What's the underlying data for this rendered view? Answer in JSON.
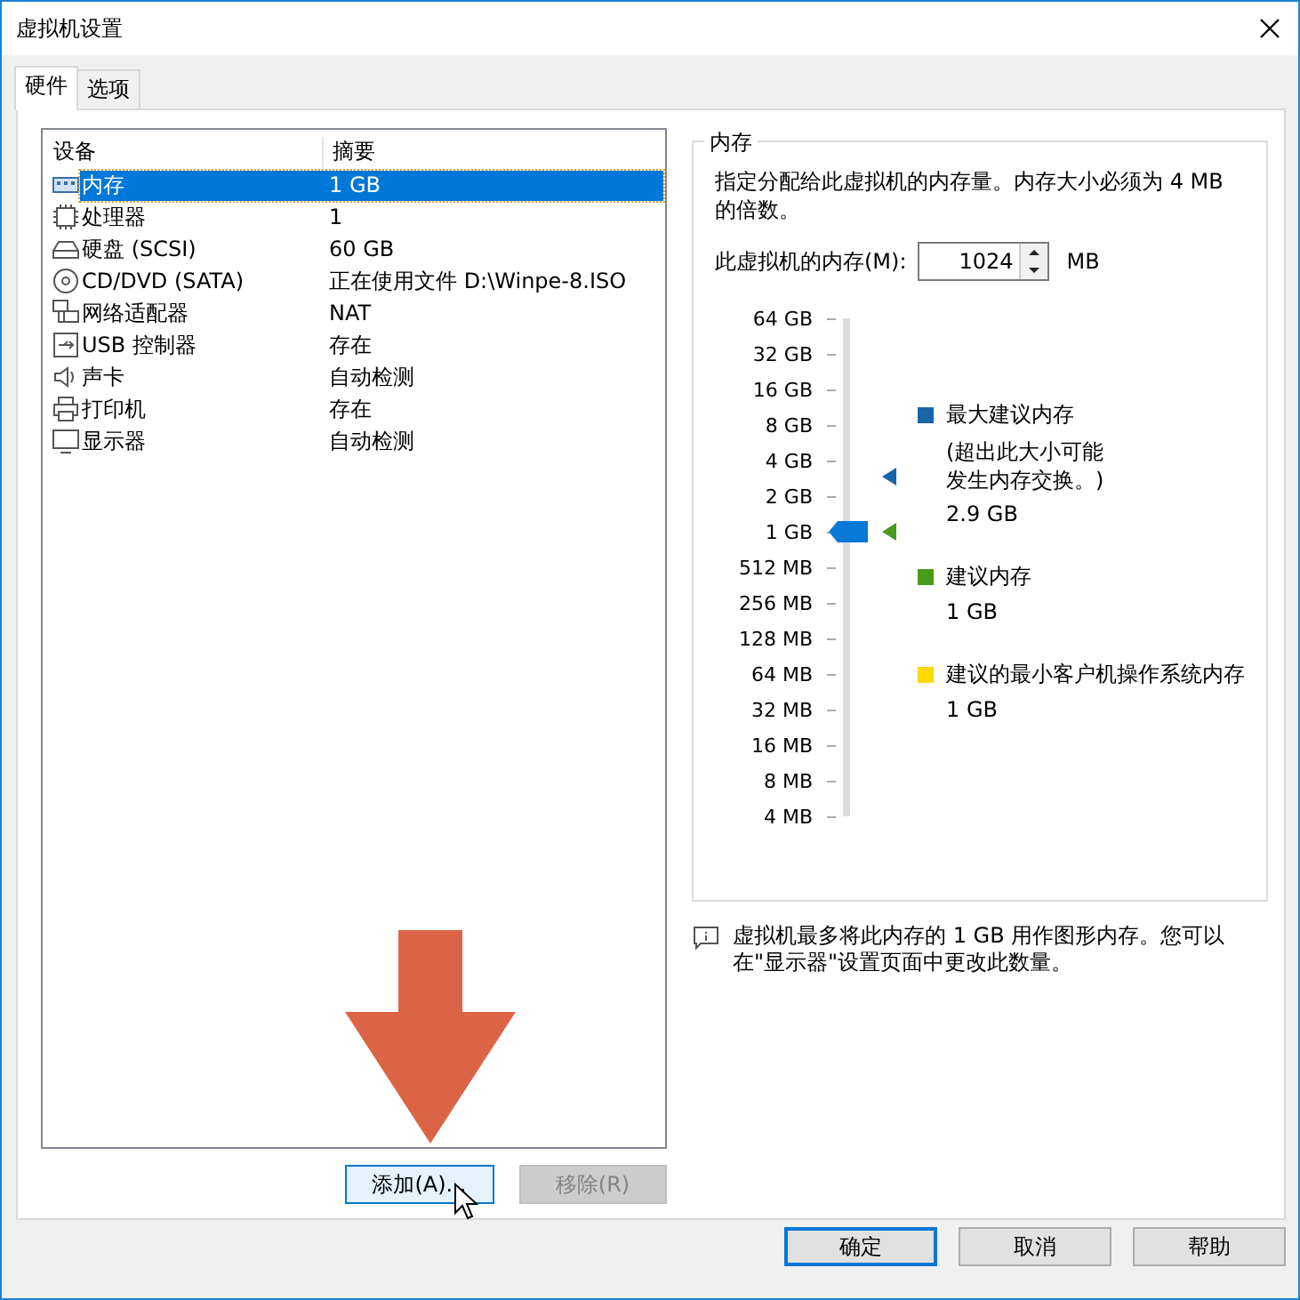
{
  "window": {
    "title": "虚拟机设置"
  },
  "tabs": [
    {
      "label": "硬件",
      "selected": true
    },
    {
      "label": "选项",
      "selected": false
    }
  ],
  "device_table": {
    "columns": [
      "设备",
      "摘要"
    ],
    "rows": [
      {
        "kind": "memory",
        "device": "内存",
        "summary": "1 GB",
        "selected": true
      },
      {
        "kind": "cpu",
        "device": "处理器",
        "summary": "1",
        "selected": false
      },
      {
        "kind": "disk",
        "device": "硬盘 (SCSI)",
        "summary": "60 GB",
        "selected": false
      },
      {
        "kind": "cdrom",
        "device": "CD/DVD (SATA)",
        "summary": "正在使用文件 D:\\Winpe-8.ISO",
        "selected": false
      },
      {
        "kind": "network",
        "device": "网络适配器",
        "summary": "NAT",
        "selected": false
      },
      {
        "kind": "usb",
        "device": "USB 控制器",
        "summary": "存在",
        "selected": false
      },
      {
        "kind": "sound",
        "device": "声卡",
        "summary": "自动检测",
        "selected": false
      },
      {
        "kind": "printer",
        "device": "打印机",
        "summary": "存在",
        "selected": false
      },
      {
        "kind": "display",
        "device": "显示器",
        "summary": "自动检测",
        "selected": false
      }
    ]
  },
  "device_buttons": [
    {
      "label": "添加(A)...",
      "focused": true,
      "disabled": false
    },
    {
      "label": "移除(R)",
      "focused": false,
      "disabled": true
    }
  ],
  "memory": {
    "group_title": "内存",
    "description": "指定分配给此虚拟机的内存量。内存大小必须为 4 MB 的倍数。",
    "field_label": "此虚拟机的内存(M):",
    "value": "1024",
    "unit": "MB",
    "slider": {
      "ticks": [
        "64 GB",
        "32 GB",
        "16 GB",
        "8 GB",
        "4 GB",
        "2 GB",
        "1 GB",
        "512 MB",
        "256 MB",
        "128 MB",
        "64 MB",
        "32 MB",
        "16 MB",
        "8 MB",
        "4 MB"
      ],
      "level": 0.571
    },
    "markers": [
      {
        "color": "#1a64a8",
        "level": 0.681
      },
      {
        "color": "#4a9a1c",
        "level": 0.571
      }
    ],
    "legend": [
      {
        "color": "#1a64a8",
        "title": "最大建议内存",
        "note": "(超出此大小可能发生内存交换。)",
        "value": "2.9 GB"
      },
      {
        "color": "#4a9a1c",
        "title": "建议内存",
        "value": "1 GB"
      },
      {
        "color": "#ffd800",
        "title": "建议的最小客户机操作系统内存",
        "value": "1 GB"
      }
    ],
    "info": "虚拟机最多将此内存的 1 GB 用作图形内存。您可以在\"显示器\"设置页面中更改此数量。"
  },
  "dialog_buttons": [
    {
      "label": "确定",
      "default": true
    },
    {
      "label": "取消",
      "default": false
    },
    {
      "label": "帮助",
      "default": false
    }
  ]
}
